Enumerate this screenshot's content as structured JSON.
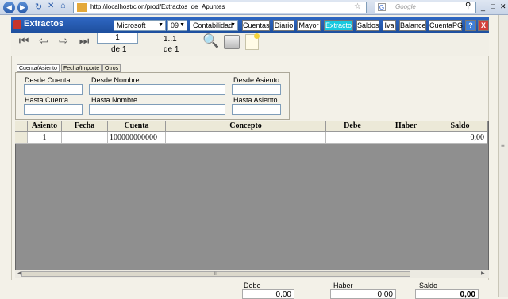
{
  "browser": {
    "url": "http://localhost/clon/prod/Extractos_de_Apuntes",
    "search_placeholder": "Google"
  },
  "app": {
    "title": "Extractos",
    "company_select": "Microsoft",
    "year_select": "09",
    "area_select": "Contabilidad",
    "nav_buttons": [
      "Cuentas",
      "Diario",
      "Mayor",
      "Extracto",
      "Saldos",
      "Iva",
      "Balance",
      "CuentaPG"
    ],
    "active_nav": "Extracto",
    "help_label": "?",
    "close_label": "X"
  },
  "pager": {
    "page_value": "1",
    "page_of": "de 1",
    "range": "1..1",
    "range_of": "de 1"
  },
  "tabs": [
    "Cuenta/Asiento",
    "Fecha/Importe",
    "Otros"
  ],
  "filters": {
    "desde_cuenta": "Desde Cuenta",
    "desde_nombre": "Desde Nombre",
    "desde_asiento": "Desde Asiento",
    "hasta_cuenta": "Hasta Cuenta",
    "hasta_nombre": "Hasta Nombre",
    "hasta_asiento": "Hasta Asiento"
  },
  "grid": {
    "columns": [
      "Asiento",
      "Fecha",
      "Cuenta",
      "Concepto",
      "Debe",
      "Haber",
      "Saldo"
    ],
    "rows": [
      {
        "asiento": "1",
        "fecha": "",
        "cuenta": "100000000000",
        "concepto": "",
        "debe": "",
        "haber": "",
        "saldo": "0,00"
      }
    ],
    "scroll_thumb_label": "III"
  },
  "totals": {
    "debe_label": "Debe",
    "debe_value": "0,00",
    "haber_label": "Haber",
    "haber_value": "0,00",
    "saldo_label": "Saldo",
    "saldo_value": "0,00"
  }
}
